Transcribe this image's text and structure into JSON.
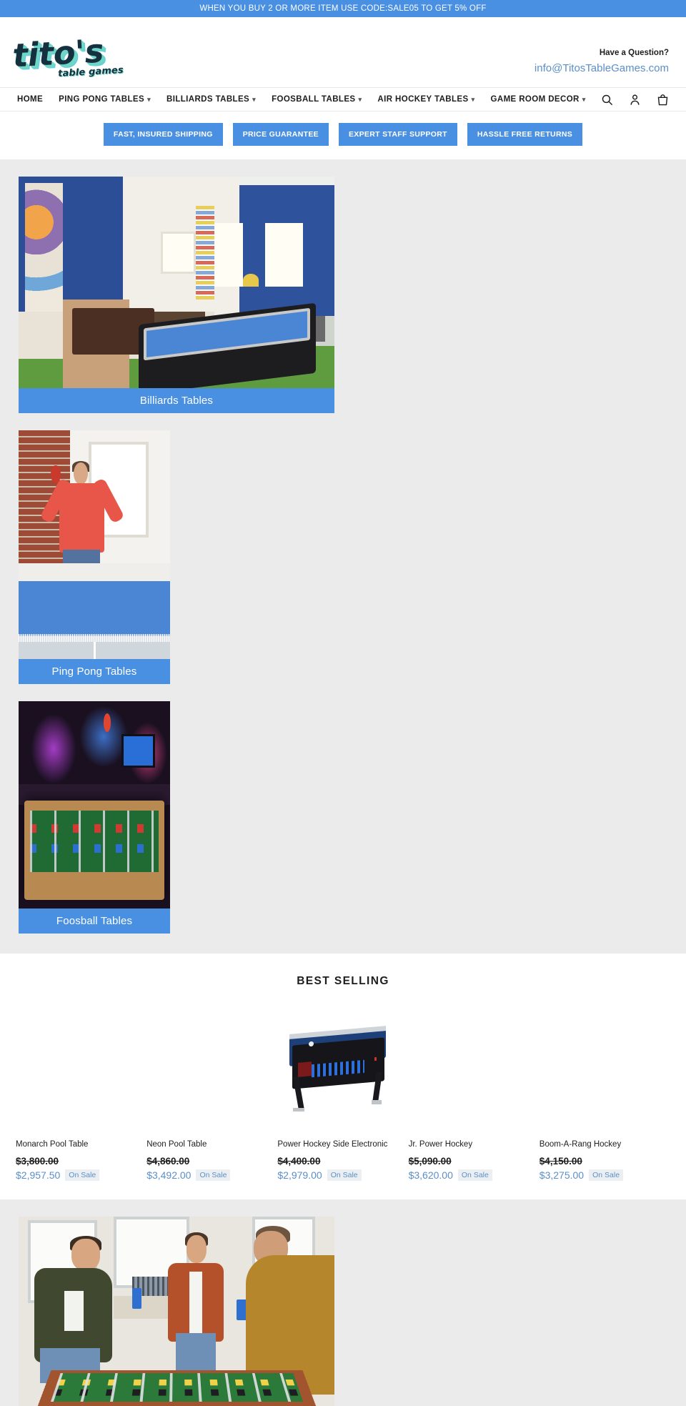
{
  "announcement": {
    "text": "WHEN YOU BUY 2 OR MORE ITEM USE CODE:SALE05 TO GET 5% OFF",
    "bg_color": "#4a90e2"
  },
  "header": {
    "logo": {
      "main": "tito's",
      "sub": "table games"
    },
    "contact": {
      "question": "Have a Question?",
      "email": "info@TitosTableGames.com",
      "email_color": "#5b8fc9"
    }
  },
  "nav": {
    "items": [
      {
        "label": "HOME",
        "has_dropdown": false
      },
      {
        "label": "PING PONG TABLES",
        "has_dropdown": true
      },
      {
        "label": "BILLIARDS TABLES",
        "has_dropdown": true
      },
      {
        "label": "FOOSBALL TABLES",
        "has_dropdown": true
      },
      {
        "label": "AIR HOCKEY TABLES",
        "has_dropdown": true
      },
      {
        "label": "GAME ROOM DECOR",
        "has_dropdown": true
      }
    ],
    "icons": [
      "search-icon",
      "account-icon",
      "cart-icon"
    ]
  },
  "features": [
    {
      "label": "FAST, INSURED SHIPPING"
    },
    {
      "label": "PRICE GUARANTEE"
    },
    {
      "label": "EXPERT STAFF SUPPORT"
    },
    {
      "label": "HASSLE FREE RETURNS"
    }
  ],
  "collections": [
    {
      "label": "Billiards Tables",
      "size": "wide",
      "scene": "billiards"
    },
    {
      "label": "Ping Pong Tables",
      "size": "small",
      "scene": "pingpong"
    },
    {
      "label": "Foosball Tables",
      "size": "small",
      "scene": "foosball"
    }
  ],
  "best_selling": {
    "title": "BEST SELLING",
    "sale_badge": "On Sale",
    "products": [
      {
        "name": "Monarch Pool Table",
        "price_old": "$3,800.00",
        "price_new": "$2,957.50",
        "badge": "On Sale",
        "has_image": false
      },
      {
        "name": "Neon Pool Table",
        "price_old": "$4,860.00",
        "price_new": "$3,492.00",
        "badge": "On Sale",
        "has_image": false
      },
      {
        "name": "Power Hockey Side Electronic",
        "price_old": "$4,400.00",
        "price_new": "$2,979.00",
        "badge": "On Sale",
        "has_image": true
      },
      {
        "name": "Jr. Power Hockey",
        "price_old": "$5,090.00",
        "price_new": "$3,620.00",
        "badge": "On Sale",
        "has_image": false
      },
      {
        "name": "Boom-A-Rang Hockey",
        "price_old": "$4,150.00",
        "price_new": "$3,275.00",
        "badge": "On Sale",
        "has_image": false
      }
    ]
  },
  "bottom_hero": {
    "alt": "friends playing foosball"
  },
  "theme": {
    "accent": "#4a90e2",
    "link": "#5b8fc9",
    "page_bg": "#ffffff",
    "section_bg": "#ebebeb",
    "text": "#1c1d1d"
  }
}
